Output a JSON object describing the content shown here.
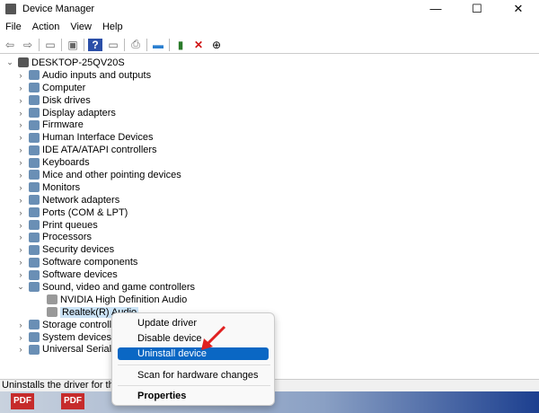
{
  "window": {
    "title": "Device Manager",
    "minimize": "—",
    "maximize": "☐",
    "close": "✕"
  },
  "menubar": [
    "File",
    "Action",
    "View",
    "Help"
  ],
  "toolbar": [
    "back-icon",
    "forward-icon",
    "properties-icon",
    "show-hide-icon",
    "help-icon",
    "view-icon",
    "print-icon",
    "monitor-icon",
    "update-driver-icon",
    "uninstall-icon",
    "scan-icon"
  ],
  "tree": {
    "root": "DESKTOP-25QV20S",
    "items": [
      {
        "label": "Audio inputs and outputs",
        "expanded": false
      },
      {
        "label": "Computer",
        "expanded": false
      },
      {
        "label": "Disk drives",
        "expanded": false
      },
      {
        "label": "Display adapters",
        "expanded": false
      },
      {
        "label": "Firmware",
        "expanded": false
      },
      {
        "label": "Human Interface Devices",
        "expanded": false
      },
      {
        "label": "IDE ATA/ATAPI controllers",
        "expanded": false
      },
      {
        "label": "Keyboards",
        "expanded": false
      },
      {
        "label": "Mice and other pointing devices",
        "expanded": false
      },
      {
        "label": "Monitors",
        "expanded": false
      },
      {
        "label": "Network adapters",
        "expanded": false
      },
      {
        "label": "Ports (COM & LPT)",
        "expanded": false
      },
      {
        "label": "Print queues",
        "expanded": false
      },
      {
        "label": "Processors",
        "expanded": false
      },
      {
        "label": "Security devices",
        "expanded": false
      },
      {
        "label": "Software components",
        "expanded": false
      },
      {
        "label": "Software devices",
        "expanded": false
      },
      {
        "label": "Sound, video and game controllers",
        "expanded": true
      },
      {
        "label": "NVIDIA High Definition Audio",
        "child": true
      },
      {
        "label": "Realtek(R) Audio",
        "child": true,
        "selected": true
      },
      {
        "label": "Storage controllers",
        "expanded": false
      },
      {
        "label": "System devices",
        "expanded": false
      },
      {
        "label": "Universal Serial Bus",
        "expanded": false
      }
    ]
  },
  "context_menu": [
    "Update driver",
    "Disable device",
    "Uninstall device",
    "Scan for hardware changes",
    "Properties"
  ],
  "status": "Uninstalls the driver for the sele",
  "taskbar": [
    "PDF",
    "PDF"
  ],
  "colors": {
    "highlight": "#0a67c4",
    "arrow": "#e02020"
  }
}
